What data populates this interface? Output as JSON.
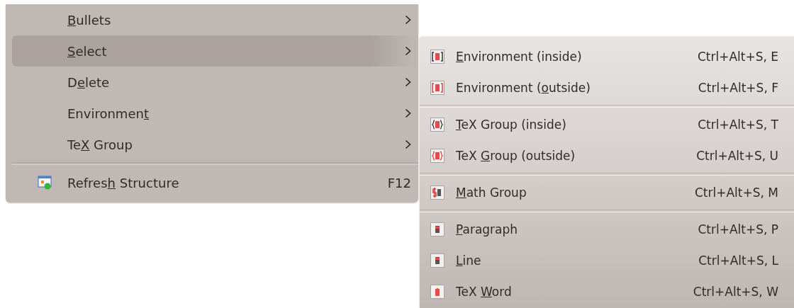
{
  "menu": {
    "items": [
      {
        "kind": "submenu",
        "access_key": "B",
        "label_after": "ullets",
        "selected": false
      },
      {
        "kind": "submenu",
        "access_key": "S",
        "label_after": "elect",
        "selected": true
      },
      {
        "kind": "submenu",
        "label_before": "D",
        "access_key": "e",
        "label_after": "lete",
        "selected": false
      },
      {
        "kind": "submenu",
        "label_before": "Environmen",
        "access_key": "t",
        "selected": false
      },
      {
        "kind": "submenu",
        "label_before": "Te",
        "access_key": "X",
        "label_after": " Group",
        "selected": false
      },
      {
        "kind": "separator"
      },
      {
        "kind": "action",
        "label_before": "Refres",
        "access_key": "h",
        "label_after": " Structure",
        "shortcut": "F12",
        "selected": false
      }
    ]
  },
  "submenu": {
    "items": [
      {
        "kind": "action",
        "access_key": "E",
        "label_after": "nvironment (inside)",
        "shortcut": "Ctrl+Alt+S, E"
      },
      {
        "kind": "action",
        "label_before": "Environment (",
        "access_key": "o",
        "label_after": "utside)",
        "shortcut": "Ctrl+Alt+S, F"
      },
      {
        "kind": "separator"
      },
      {
        "kind": "action",
        "access_key": "T",
        "label_after": "eX Group (inside)",
        "shortcut": "Ctrl+Alt+S, T"
      },
      {
        "kind": "action",
        "label_before": "TeX ",
        "access_key": "G",
        "label_after": "roup (outside)",
        "shortcut": "Ctrl+Alt+S, U"
      },
      {
        "kind": "separator"
      },
      {
        "kind": "action",
        "access_key": "M",
        "label_after": "ath Group",
        "shortcut": "Ctrl+Alt+S, M"
      },
      {
        "kind": "separator"
      },
      {
        "kind": "action",
        "access_key": "P",
        "label_after": "aragraph",
        "shortcut": "Ctrl+Alt+S, P"
      },
      {
        "kind": "action",
        "access_key": "L",
        "label_after": "ine",
        "shortcut": "Ctrl+Alt+S, L"
      },
      {
        "kind": "action",
        "label_before": "TeX ",
        "access_key": "W",
        "label_after": "ord",
        "shortcut": "Ctrl+Alt+S, W"
      }
    ]
  }
}
